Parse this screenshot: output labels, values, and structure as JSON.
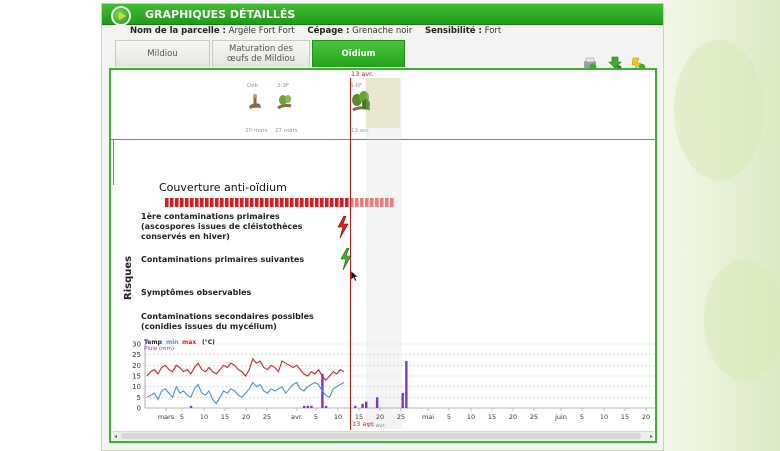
{
  "window": {
    "title": "GRAPHIQUES DÉTAILLÉS"
  },
  "info": {
    "parcelle_label": "Nom de la parcelle :",
    "parcelle_value": "Argèle Fort Fort",
    "cepage_label": "Cépage :",
    "cepage_value": "Grenache noir",
    "sensibilite_label": "Sensibilité :",
    "sensibilite_value": "Fort"
  },
  "tabs": [
    {
      "label": "Mildiou",
      "active": false
    },
    {
      "label": "Maturation des œufs de Mildiou",
      "active": false
    },
    {
      "label": "Oïdium",
      "active": true
    }
  ],
  "toolbar_icons": [
    "print-icon",
    "export-icon",
    "help-icon"
  ],
  "stages": [
    {
      "code": "Déb",
      "date": "20 mars"
    },
    {
      "code": "2-3F",
      "date": "27 mars"
    },
    {
      "code": "5-6F",
      "date": "13 avr."
    }
  ],
  "today_label": "13 avr.",
  "future_label": "17 avr.",
  "couverture_title": "Couverture anti-oïdium",
  "risks": {
    "axis_label": "Risques",
    "rows": [
      "1ère contaminations primaires (ascospores issues de cléistothèces conservés en hiver)",
      "Contaminations primaires suivantes",
      "Symptômes observables",
      "Contaminations secondaires possibles (conidies issues du mycélium)"
    ]
  },
  "colors": {
    "green": "#39b52b",
    "red": "#d41414",
    "temp_min": "#4a90e2",
    "temp_max": "#e02020",
    "rain": "#7a36d6"
  },
  "chart_data": {
    "type": "line",
    "legend": {
      "temp": "Temp",
      "min": "min",
      "max": "max",
      "unit": "(°C)",
      "rain": "Pluie (mm)"
    },
    "ylim": [
      0,
      30
    ],
    "yticks": [
      0,
      5,
      10,
      15,
      20,
      25,
      30
    ],
    "xticks": [
      "mars",
      "5",
      "10",
      "15",
      "20",
      "25",
      "avr.",
      "5",
      "10",
      "15",
      "20",
      "25",
      "mai",
      "5",
      "10",
      "15",
      "20",
      "25",
      "juin",
      "5",
      "10",
      "15",
      "20"
    ],
    "series": [
      {
        "name": "max",
        "values": [
          15,
          17,
          18,
          16,
          19,
          20,
          18,
          17,
          20,
          19,
          17,
          18,
          16,
          19,
          21,
          18,
          17,
          19,
          17,
          16,
          18,
          20,
          19,
          21,
          20,
          18,
          17,
          15,
          18,
          23,
          21,
          22,
          19,
          18,
          20,
          19,
          17,
          22,
          21,
          20,
          19,
          20,
          18,
          16,
          15,
          17,
          16,
          18,
          15,
          13,
          15,
          17,
          16,
          18,
          17
        ]
      },
      {
        "name": "min",
        "values": [
          5,
          6,
          7,
          4,
          8,
          9,
          7,
          5,
          10,
          7,
          8,
          6,
          5,
          9,
          11,
          7,
          6,
          8,
          4,
          2,
          5,
          8,
          7,
          9,
          8,
          6,
          5,
          7,
          9,
          12,
          10,
          11,
          8,
          7,
          9,
          8,
          9,
          10,
          7,
          9,
          11,
          12,
          9,
          8,
          10,
          11,
          12,
          11,
          8,
          6,
          5,
          9,
          10,
          11,
          12
        ]
      },
      {
        "name": "Pluie (mm)",
        "values": [
          0,
          0,
          0,
          0,
          0,
          0,
          0,
          0,
          0,
          0,
          0,
          0,
          1,
          0,
          0,
          0,
          0,
          0,
          0,
          0,
          0,
          0,
          0,
          0,
          0,
          0,
          0,
          0,
          0,
          0,
          0,
          0,
          0,
          0,
          0,
          0,
          0,
          0,
          0,
          0,
          0,
          0,
          0,
          1,
          1,
          1,
          0,
          0,
          16,
          1,
          0,
          0,
          0,
          0,
          0,
          0,
          0,
          1,
          0,
          2,
          3,
          0,
          0,
          5,
          0,
          0,
          0,
          0,
          0,
          0,
          7,
          22
        ]
      }
    ]
  }
}
